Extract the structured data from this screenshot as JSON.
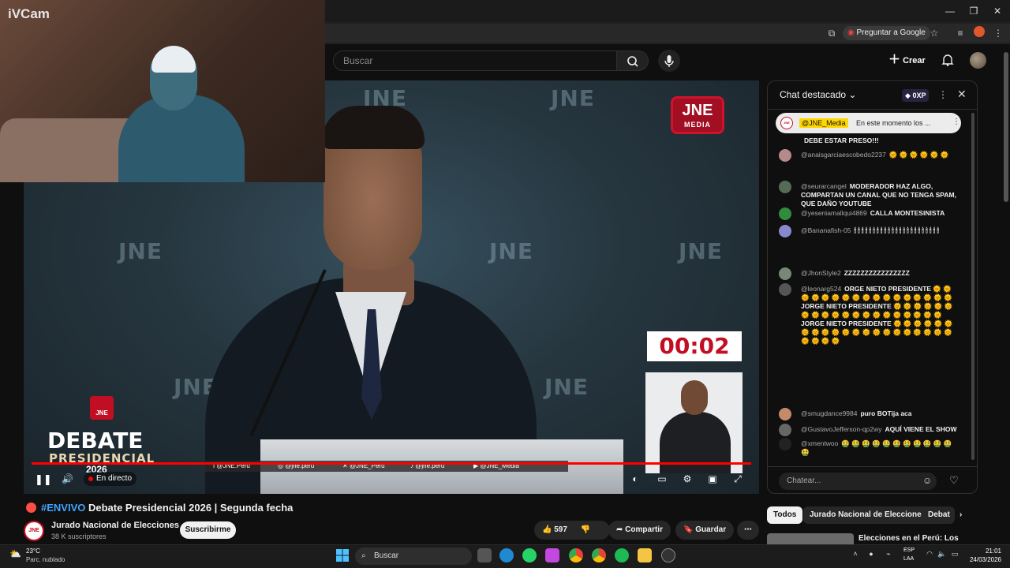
{
  "browser": {
    "ask_google": "Preguntar a Google"
  },
  "webcam": {
    "label": "iVCam"
  },
  "header": {
    "search_placeholder": "Buscar",
    "create_label": "Crear"
  },
  "player": {
    "timer": "00:02",
    "watermark": "JNE",
    "logo_title": "JNE",
    "logo_subtitle": "MEDIA",
    "brand_debate": "DEBATE",
    "brand_presidencial": "PRESIDENCIAL",
    "brand_year": "2026",
    "brand_icon": "JNE",
    "live_label": "En directo",
    "social": [
      "@JNE.Peru",
      "@jne.peru",
      "@JNE_Peru",
      "@jne.peru",
      "@JNE_Media"
    ]
  },
  "video": {
    "hashtag": "#ENVIVO",
    "title": " Debate Presidencial 2026 | Segunda fecha",
    "channel_name": "Jurado Nacional de Elecciones",
    "channel_logo": "JNE",
    "subscribers": "38 K suscriptores",
    "subscribe_label": "Suscribirme",
    "likes": "597",
    "share_label": "Compartir",
    "save_label": "Guardar"
  },
  "chat": {
    "title": "Chat destacado",
    "xp": "0XP",
    "pinned_author": "@JNE_Media",
    "pinned_text": "En este momento los ...",
    "input_placeholder": "Chatear...",
    "messages": [
      {
        "author": "",
        "text": "DEBE ESTAR PRESO!!!",
        "avatar": "#444444"
      },
      {
        "author": "@anaisgarciaescobedo2237",
        "text": "🌞 🌞 🌞 🌞 🌞 🌞",
        "avatar": "#b58a8a"
      },
      {
        "author": "@seurarcangel",
        "text": "MODERADOR HAZ ALGO, COMPARTAN UN CANAL QUE NO TENGA SPAM, QUE DAÑO YOUTUBE",
        "avatar": "#556b55"
      },
      {
        "author": "@yeseniamallqui4869",
        "text": "CALLA MONTESINISTA",
        "avatar": "#2f8c3c"
      },
      {
        "author": "@Bananafish-05",
        "text": "🕯 🕯 🕯 🕯 🕯 🕯 🕯 🕯 🕯 🕯 🕯 🕯 🕯 🕯 🕯 🕯 🕯 🕯 🕯 🕯 🕯 🕯 🕯",
        "avatar": "#8888cc"
      },
      {
        "author": "@JhonStyle2",
        "text": "ZZZZZZZZZZZZZZZZ",
        "avatar": "#778877"
      },
      {
        "author": "@leonarg524",
        "text": "ORGE NIETO PRESIDENTE 🌞 🌞 🌞 🌞 🌞 🌞 🌞 🌞 🌞 🌞 🌞 🌞 🌞 🌞 🌞 🌞 🌞 JORGE NIETO PRESIDENTE 🌞 🌞 🌞 🌞 🌞 🌞 🌞 🌞 🌞 🌞 🌞 🌞 🌞 🌞 🌞 🌞 🌞 🌞 🌞 🌞 JORGE NIETO PRESIDENTE 🌞 🌞 🌞 🌞 🌞 🌞 🌞 🌞 🌞 🌞 🌞 🌞 🌞 🌞 🌞 🌞 🌞 🌞 🌞 🌞 🌞 🌞 🌞 🌞 🌞",
        "avatar": "#555555"
      },
      {
        "author": "@smugdance9984",
        "text": "puro BOTija aca",
        "avatar": "#c48a6a"
      },
      {
        "author": "@GustavoJefferson-qp2wy",
        "text": "AQUÍ VIENE EL SHOW",
        "avatar": "#666666"
      },
      {
        "author": "@xmentwoo",
        "text": "🤮 🤮 🤮 🤮 🤮 🤮 🤮 🤮 🤮 🤮 🤮 🤮",
        "avatar": "#222222"
      }
    ]
  },
  "chips": [
    "Todos",
    "Jurado Nacional de Elecciones",
    "Debat"
  ],
  "recommended": {
    "title": "Elecciones en el Perú: Los"
  },
  "taskbar": {
    "temp": "23°C",
    "weather": "Parc. nublado",
    "search": "Buscar",
    "lang1": "ESP",
    "lang2": "LAA",
    "time": "21:01",
    "date": "24/03/2026"
  },
  "colors": {
    "accent_red": "#c20e22",
    "yt_red": "#ff0000",
    "link_blue": "#3ea6ff"
  }
}
